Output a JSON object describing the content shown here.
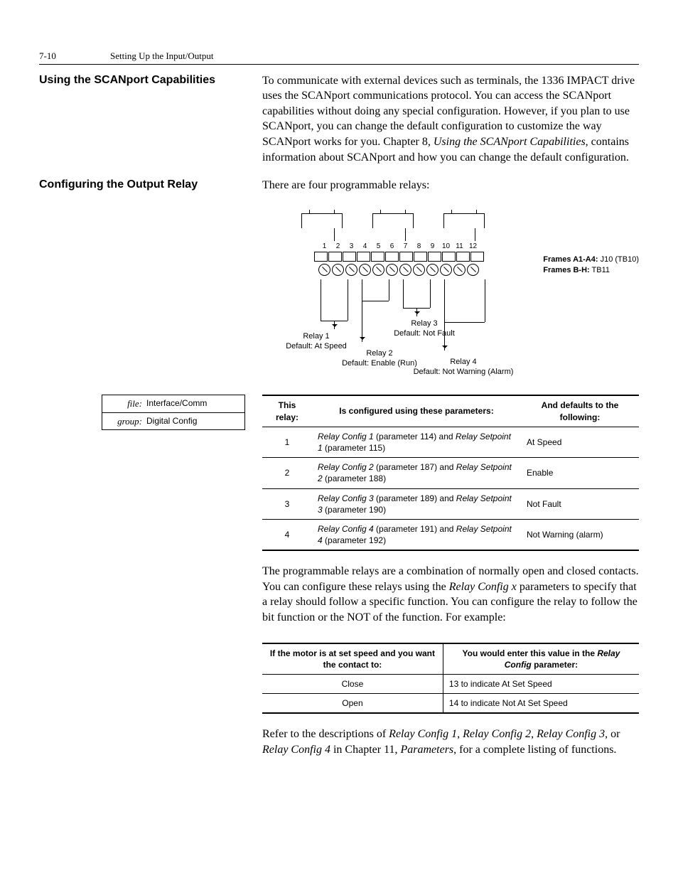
{
  "header": {
    "page_num": "7-10",
    "chapter_title": "Setting Up the Input/Output"
  },
  "sec1": {
    "heading": "Using the SCANport Capabilities",
    "body_a": "To communicate with external devices such as terminals, the 1336 IMPACT drive uses the SCANport communications protocol. You can access the SCANport capabilities without doing any special configuration. However, if you plan to use SCANport, you can change the default configuration to customize the way SCANport works for you. Chapter 8, ",
    "body_ital": "Using the SCANport Capabilities",
    "body_b": ", contains information about SCANport and how you can change the default configuration."
  },
  "sec2": {
    "heading": "Configuring the Output Relay",
    "intro": "There are four programmable relays:"
  },
  "diagram": {
    "nums": [
      "1",
      "2",
      "3",
      "4",
      "5",
      "6",
      "7",
      "8",
      "9",
      "10",
      "11",
      "12"
    ],
    "relay1_a": "Relay 1",
    "relay1_b": "Default: At Speed",
    "relay2_a": "Relay 2",
    "relay2_b": "Default: Enable (Run)",
    "relay3_a": "Relay 3",
    "relay3_b": "Default: Not Fault",
    "relay4_a": "Relay 4",
    "relay4_b": "Default: Not Warning (Alarm)",
    "frames_a_lbl": "Frames A1-A4:",
    "frames_a_val": " J10 (TB10)",
    "frames_b_lbl": "Frames B-H:",
    "frames_b_val": " TB11"
  },
  "ipbox": {
    "file_k": "file:",
    "file_v": "Interface/Comm",
    "group_k": "group:",
    "group_v": "Digital Config"
  },
  "table1": {
    "h1": "This relay:",
    "h2": "Is configured using these parameters:",
    "h3": "And defaults to the following:",
    "rows": [
      {
        "n": "1",
        "a": "Relay Config 1",
        "ap": " (parameter 114) and ",
        "b": "Relay Setpoint 1",
        "bp": " (parameter 115)",
        "d": "At Speed"
      },
      {
        "n": "2",
        "a": "Relay Config 2",
        "ap": " (parameter 187) and ",
        "b": "Relay Setpoint 2",
        "bp": " (parameter 188)",
        "d": "Enable"
      },
      {
        "n": "3",
        "a": "Relay Config 3",
        "ap": " (parameter 189) and ",
        "b": "Relay Setpoint 3",
        "bp": " (parameter 190)",
        "d": "Not Fault"
      },
      {
        "n": "4",
        "a": "Relay Config 4",
        "ap": " (parameter 191) and ",
        "b": "Relay Setpoint 4",
        "bp": " (parameter 192)",
        "d": "Not Warning (alarm)"
      }
    ]
  },
  "para2": {
    "a": "The programmable relays are a combination of normally open and closed contacts. You can configure these relays using the ",
    "b": "Relay Config x",
    "c": " parameters to specify that a relay should follow a specific function. You can configure the relay to follow the bit function or the NOT of the function. For example:"
  },
  "table2": {
    "h1": "If the motor is at set speed and you want the contact to:",
    "h2a": "You would enter this value in the ",
    "h2b": "Relay Config",
    "h2c": " parameter:",
    "r1a": "Close",
    "r1b": "13 to indicate At Set Speed",
    "r2a": "Open",
    "r2b": "14 to indicate Not At Set Speed"
  },
  "para3": {
    "a": "Refer to the descriptions of ",
    "b": "Relay Config 1",
    "c": ", ",
    "d": "Relay Config 2",
    "e": ", ",
    "f": "Relay Config 3",
    "g": ", or ",
    "h": "Relay Config 4",
    "i": " in Chapter 11, ",
    "j": "Parameters",
    "k": ", for a complete listing of functions."
  }
}
